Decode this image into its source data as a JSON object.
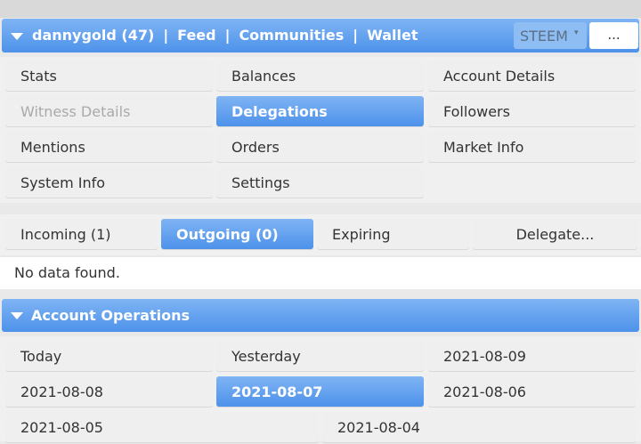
{
  "header": {
    "account": "dannygold (47)",
    "nav": [
      "Feed",
      "Communities",
      "Wallet"
    ],
    "separator": "|",
    "currency": "STEEM",
    "currency_arrow": "▾",
    "more_label": "..."
  },
  "menu": [
    {
      "label": "Stats",
      "state": "normal"
    },
    {
      "label": "Balances",
      "state": "normal"
    },
    {
      "label": "Account Details",
      "state": "normal"
    },
    {
      "label": "Witness Details",
      "state": "disabled"
    },
    {
      "label": "Delegations",
      "state": "active"
    },
    {
      "label": "Followers",
      "state": "normal"
    },
    {
      "label": "Mentions",
      "state": "normal"
    },
    {
      "label": "Orders",
      "state": "normal"
    },
    {
      "label": "Market Info",
      "state": "normal"
    },
    {
      "label": "System Info",
      "state": "normal"
    },
    {
      "label": "Settings",
      "state": "normal"
    }
  ],
  "delegation_tabs": [
    {
      "label": "Incoming (1)",
      "state": "normal"
    },
    {
      "label": "Outgoing (0)",
      "state": "active"
    },
    {
      "label": "Expiring",
      "state": "normal"
    },
    {
      "label": "Delegate...",
      "state": "normal"
    }
  ],
  "no_data_text": "No data found.",
  "operations": {
    "title": "Account Operations",
    "dates": [
      {
        "label": "Today",
        "state": "normal"
      },
      {
        "label": "Yesterday",
        "state": "normal"
      },
      {
        "label": "2021-08-09",
        "state": "normal"
      },
      {
        "label": "2021-08-08",
        "state": "normal"
      },
      {
        "label": "2021-08-07",
        "state": "active"
      },
      {
        "label": "2021-08-06",
        "state": "normal"
      },
      {
        "label": "2021-08-05",
        "state": "normal"
      },
      {
        "label": "2021-08-04",
        "state": "normal"
      }
    ]
  },
  "colors": {
    "accent": "#4d92ea",
    "accent_light": "#7fb4f4",
    "tile_bg": "#efefef"
  }
}
